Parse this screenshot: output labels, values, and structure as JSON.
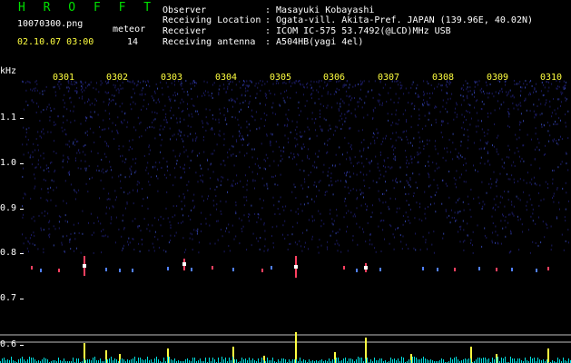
{
  "header": {
    "app_title": "H R O F F T",
    "filename": "10070300.png",
    "meteor_label": "meteor",
    "datetime": "02.10.07 03:00",
    "meteor_count": "14",
    "fields": [
      {
        "label": "Observer",
        "value": ": Masayuki Kobayashi"
      },
      {
        "label": "Receiving Location",
        "value": ": Ogata-vill. Akita-Pref. JAPAN (139.96E, 40.02N)"
      },
      {
        "label": "Receiver",
        "value": ": ICOM IC-575 53.7492(@LCD)MHz USB"
      },
      {
        "label": "Receiving antenna",
        "value": ": A504HB(yagi 4el)"
      }
    ]
  },
  "axis": {
    "unit": "kHz",
    "y_ticks": [
      "1.1",
      "1.0",
      "0.9",
      "0.8",
      "0.7",
      "0.6"
    ],
    "x_ticks": [
      "0301",
      "0302",
      "0303",
      "0304",
      "0305",
      "0306",
      "0307",
      "0308",
      "0309",
      "0310"
    ]
  },
  "colors": {
    "background": "#000000",
    "noise": "#1a1a60",
    "echo": "#ff4060",
    "bar": "#ffff40",
    "base": "#00e0e0"
  }
}
